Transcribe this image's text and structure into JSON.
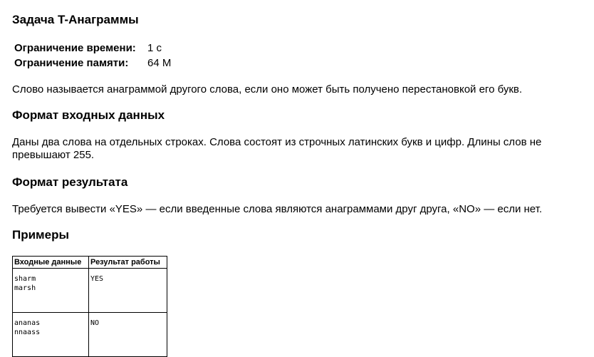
{
  "title": "Задача T-Анаграммы",
  "limits": {
    "time_label": "Ограничение времени:",
    "time_value": "1 с",
    "memory_label": "Ограничение памяти:",
    "memory_value": "64 M"
  },
  "description": "Слово называется анаграммой другого слова, если оно может быть получено перестановкой его букв.",
  "input_section": {
    "heading": "Формат входных данных",
    "text": "Даны два слова на отдельных строках. Слова состоят из строчных латинских букв и цифр. Длины слов не превышают 255."
  },
  "output_section": {
    "heading": "Формат результата",
    "text": "Требуется вывести «YES» — если введенные слова являются анаграммами друг друга, «NO» — если нет."
  },
  "examples": {
    "heading": "Примеры",
    "columns": [
      "Входные данные",
      "Результат работы"
    ],
    "rows": [
      {
        "input": [
          "sharm",
          "marsh"
        ],
        "output": [
          "YES"
        ]
      },
      {
        "input": [
          "ananas",
          "nnaass"
        ],
        "output": [
          "NO"
        ]
      }
    ]
  }
}
